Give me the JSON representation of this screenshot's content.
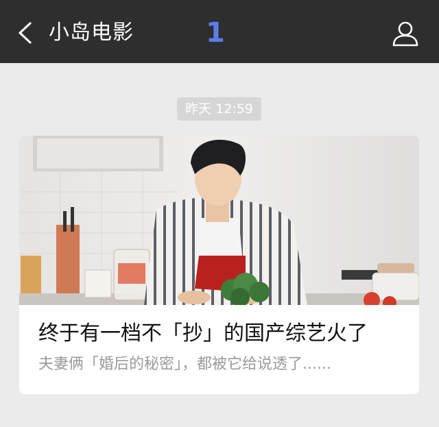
{
  "header": {
    "title": "小岛电影",
    "badge": "1",
    "back_icon": "chevron-left-icon",
    "profile_icon": "person-icon"
  },
  "message": {
    "timestamp": "昨天 12:59"
  },
  "article": {
    "title": "终于有一档不「抄」的国产综艺火了",
    "description": "夫妻俩「婚后的秘密」，都被它给说透了......"
  },
  "colors": {
    "header_bg": "#2e2e2e",
    "page_bg": "#ebebeb",
    "badge": "#5b7ee8",
    "timestamp_bg": "#d6d6d6"
  }
}
